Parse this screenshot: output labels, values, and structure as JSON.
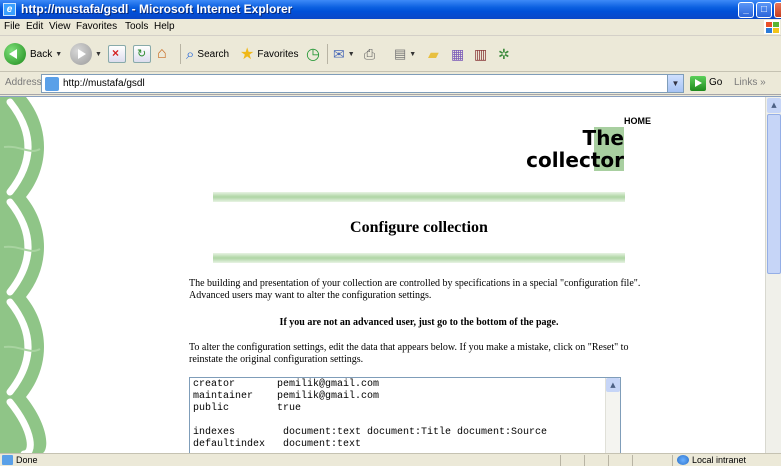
{
  "window": {
    "title": "http://mustafa/gsdl - Microsoft Internet Explorer"
  },
  "menu": [
    "File",
    "Edit",
    "View",
    "Favorites",
    "Tools",
    "Help"
  ],
  "toolbar": {
    "back_label": "Back",
    "search_label": "Search",
    "favorites_label": "Favorites"
  },
  "address": {
    "label": "Address",
    "url": "http://mustafa/gsdl",
    "go_label": "Go",
    "links_label": "Links"
  },
  "page": {
    "home_link": "HOME",
    "logo_line1": "The",
    "logo_line2": "collector",
    "title": "Configure collection",
    "para1": "The building and presentation of your collection are controlled by specifications in a special \"configuration file\". Advanced users may want to alter the configuration settings.",
    "para2": "If you are not an advanced user, just go to the bottom of the page.",
    "para3": "To alter the configuration settings, edit the data that appears below. If you make a mistake, click on \"Reset\" to reinstate the original configuration settings.",
    "config_lines": [
      "creator       pemilik@gmail.com",
      "maintainer    pemilik@gmail.com",
      "public        true",
      "",
      "indexes        document:text document:Title document:Source",
      "defaultindex   document:text"
    ]
  },
  "status": {
    "text": "Done",
    "zone": "Local intranet"
  },
  "colors": {
    "accent_green": "#b2d7a8",
    "title_bar_blue": "#0a5fe0"
  }
}
